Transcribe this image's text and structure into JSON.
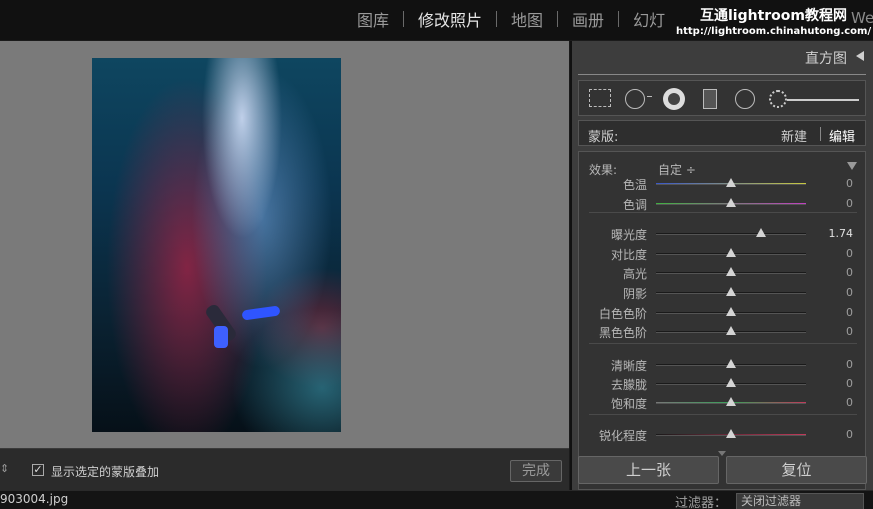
{
  "top_nav": {
    "modules": [
      "图库",
      "修改照片",
      "地图",
      "画册",
      "幻灯"
    ],
    "active": "修改照片",
    "watermark_title": "互通lightroom教程网",
    "watermark_url": "http://lightroom.chinahutong.com/",
    "partial_module": "We"
  },
  "canvas": {
    "overlay_checkbox_checked": true,
    "overlay_label": "显示选定的蒙版叠加",
    "done_label": "完成"
  },
  "filmstrip": {
    "filename": "903004.jpg",
    "filter_label": "过滤器：",
    "filter_value": "关闭过滤器"
  },
  "panel": {
    "histogram_label": "直方图",
    "mask_label": "蒙版:",
    "mask_new": "新建",
    "mask_edit": "编辑",
    "effect_label": "效果:",
    "effect_value": "自定 ÷",
    "sliders": [
      {
        "label": "色温",
        "value": "0",
        "position": 0.5
      },
      {
        "label": "色调",
        "value": "0",
        "position": 0.5
      },
      {
        "label": "曝光度",
        "value": "1.74",
        "position": 0.7,
        "active": true
      },
      {
        "label": "对比度",
        "value": "0",
        "position": 0.5
      },
      {
        "label": "高光",
        "value": "0",
        "position": 0.5
      },
      {
        "label": "阴影",
        "value": "0",
        "position": 0.5
      },
      {
        "label": "白色色阶",
        "value": "0",
        "position": 0.5
      },
      {
        "label": "黑色色阶",
        "value": "0",
        "position": 0.5
      },
      {
        "label": "清晰度",
        "value": "0",
        "position": 0.5
      },
      {
        "label": "去朦胧",
        "value": "0",
        "position": 0.5
      },
      {
        "label": "饱和度",
        "value": "0",
        "position": 0.5
      },
      {
        "label": "锐化程度",
        "value": "0",
        "position": 0.5
      }
    ],
    "prev_label": "上一张",
    "reset_label": "复位"
  },
  "colors": {
    "accent_text": "#e6e6e6",
    "panel_bg": "#3d3d3d",
    "canvas_bg": "#7a7a7a"
  }
}
